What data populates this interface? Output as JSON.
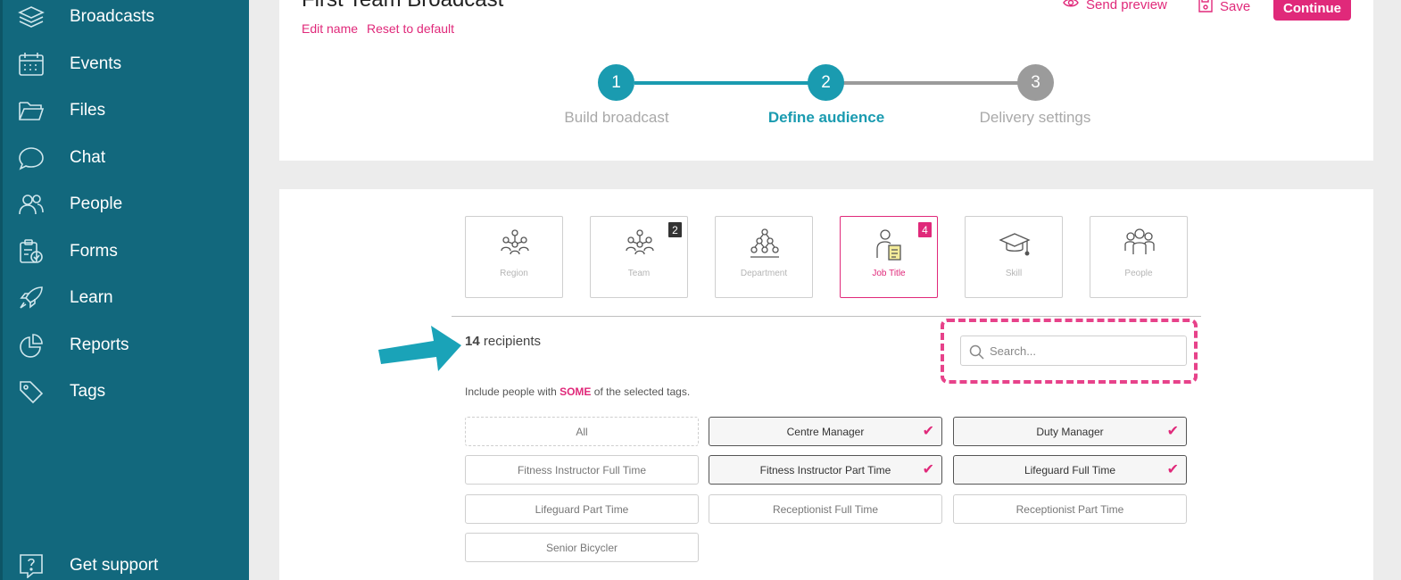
{
  "sidebar": {
    "items": [
      {
        "label": "Broadcasts",
        "icon": "layers-icon"
      },
      {
        "label": "Events",
        "icon": "calendar-icon"
      },
      {
        "label": "Files",
        "icon": "folder-icon"
      },
      {
        "label": "Chat",
        "icon": "chat-bubble-icon"
      },
      {
        "label": "People",
        "icon": "people-icon"
      },
      {
        "label": "Forms",
        "icon": "clipboard-check-icon"
      },
      {
        "label": "Learn",
        "icon": "rocket-icon"
      },
      {
        "label": "Reports",
        "icon": "pie-chart-icon"
      },
      {
        "label": "Tags",
        "icon": "tag-icon"
      }
    ],
    "support": {
      "label": "Get support",
      "icon": "help-icon"
    }
  },
  "header": {
    "title": "First Team Broadcast",
    "edit_name": "Edit name",
    "reset_default": "Reset to default",
    "send_preview": "Send preview",
    "save": "Save",
    "continue": "Continue"
  },
  "stepper": {
    "steps": [
      {
        "number": "1",
        "label": "Build broadcast",
        "state": "complete"
      },
      {
        "number": "2",
        "label": "Define audience",
        "state": "current"
      },
      {
        "number": "3",
        "label": "Delivery settings",
        "state": "upcoming"
      }
    ]
  },
  "tag_types": [
    {
      "label": "Region",
      "icon": "region-icon",
      "badge": ""
    },
    {
      "label": "Team",
      "icon": "team-icon",
      "badge": "2"
    },
    {
      "label": "Department",
      "icon": "department-icon",
      "badge": ""
    },
    {
      "label": "Job Title",
      "icon": "job-title-icon",
      "badge": "4",
      "active": true
    },
    {
      "label": "Skill",
      "icon": "graduation-cap-icon",
      "badge": ""
    },
    {
      "label": "People",
      "icon": "people-group-icon",
      "badge": ""
    }
  ],
  "recipients": {
    "count": "14",
    "label": "recipients"
  },
  "search": {
    "placeholder": "Search..."
  },
  "include": {
    "prefix": "Include people with",
    "keyword": "SOME",
    "suffix": "of the selected tags."
  },
  "tags": [
    {
      "label": "All",
      "selected": false
    },
    {
      "label": "Centre Manager",
      "selected": true
    },
    {
      "label": "Duty Manager",
      "selected": true
    },
    {
      "label": "Fitness Instructor Full Time",
      "selected": false
    },
    {
      "label": "Fitness Instructor Part Time",
      "selected": true
    },
    {
      "label": "Lifeguard Full Time",
      "selected": true
    },
    {
      "label": "Lifeguard Part Time",
      "selected": false
    },
    {
      "label": "Receptionist Full Time",
      "selected": false
    },
    {
      "label": "Receptionist Part Time",
      "selected": false
    },
    {
      "label": "Senior Bicycler",
      "selected": false
    }
  ],
  "check_mark": "✔",
  "colors": {
    "sidebar": "#12687d",
    "accent": "#e0297a",
    "teal": "#1a9bb0",
    "step_inactive": "#9b9b9b",
    "annotation_arrow": "#1aa3b8"
  }
}
